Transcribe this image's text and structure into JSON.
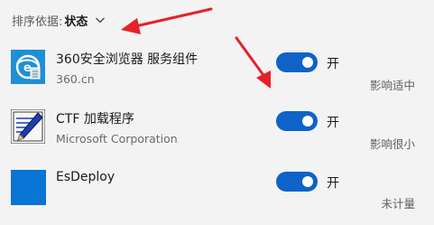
{
  "sort": {
    "label": "排序依据:",
    "value": "状态",
    "icon": "chevron-down-icon"
  },
  "apps": [
    {
      "name": "360安全浏览器 服务组件",
      "publisher": "360.cn",
      "toggle_on": true,
      "toggle_label": "开",
      "impact": "影响适中",
      "icon": "360-browser-icon"
    },
    {
      "name": "CTF 加载程序",
      "publisher": "Microsoft Corporation",
      "toggle_on": true,
      "toggle_label": "开",
      "impact": "影响很小",
      "icon": "ctf-loader-icon"
    },
    {
      "name": "EsDeploy",
      "publisher": "",
      "toggle_on": true,
      "toggle_label": "开",
      "impact": "未计量",
      "icon": "esdeploy-icon"
    }
  ],
  "colors": {
    "accent": "#0f62c7",
    "annotation_arrow": "#e8202a",
    "background": "#f3f3f3"
  }
}
